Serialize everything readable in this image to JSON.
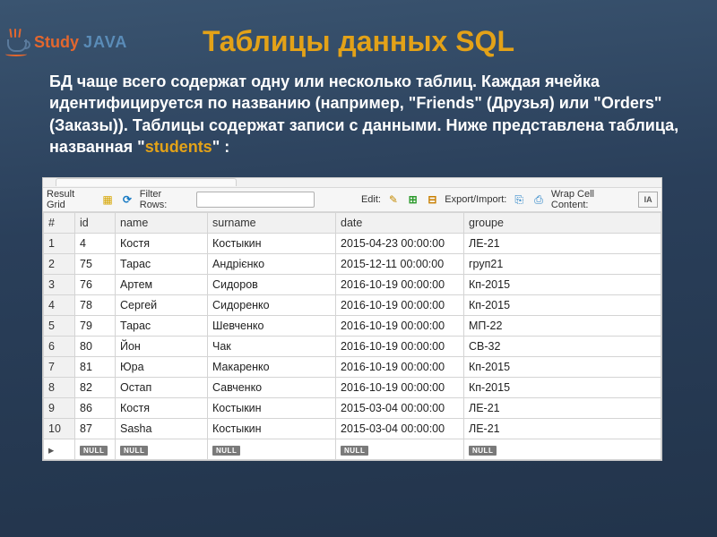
{
  "logo": {
    "study": "Study",
    "java": "JAVA"
  },
  "title": "Таблицы данных SQL",
  "para": {
    "t1": "БД чаще всего содержат одну или несколько таблиц. Каждая ячейка идентифицируется по названию (например, \"Friends\" (Друзья) или \"Orders\" (Заказы)). Таблицы содержат записи с данными. Ниже представлена таблица, названная \"",
    "hl": "students",
    "t2": "\" :"
  },
  "toolbar": {
    "result_grid": "Result Grid",
    "filter_rows": "Filter Rows:",
    "filter_placeholder": "",
    "edit": "Edit:",
    "export_import": "Export/Import:",
    "wrap_cell": "Wrap Cell Content:"
  },
  "columns": {
    "num": "#",
    "id": "id",
    "name": "name",
    "surname": "surname",
    "date": "date",
    "groupe": "groupe"
  },
  "rows": [
    {
      "n": "1",
      "id": "4",
      "name": "Костя",
      "surname": "Костыкин",
      "date": "2015-04-23 00:00:00",
      "groupe": "ЛЕ-21"
    },
    {
      "n": "2",
      "id": "75",
      "name": "Тарас",
      "surname": "Андрієнко",
      "date": "2015-12-11 00:00:00",
      "groupe": "груп21"
    },
    {
      "n": "3",
      "id": "76",
      "name": "Артем",
      "surname": "Сидоров",
      "date": "2016-10-19 00:00:00",
      "groupe": "Кп-2015"
    },
    {
      "n": "4",
      "id": "78",
      "name": "Сергей",
      "surname": "Сидоренко",
      "date": "2016-10-19 00:00:00",
      "groupe": "Кп-2015"
    },
    {
      "n": "5",
      "id": "79",
      "name": "Тарас",
      "surname": "Шевченко",
      "date": "2016-10-19 00:00:00",
      "groupe": "МП-22"
    },
    {
      "n": "6",
      "id": "80",
      "name": "Йон",
      "surname": "Чак",
      "date": "2016-10-19 00:00:00",
      "groupe": "СВ-32"
    },
    {
      "n": "7",
      "id": "81",
      "name": "Юра",
      "surname": "Макаренко",
      "date": "2016-10-19 00:00:00",
      "groupe": "Кп-2015"
    },
    {
      "n": "8",
      "id": "82",
      "name": "Остап",
      "surname": "Савченко",
      "date": "2016-10-19 00:00:00",
      "groupe": "Кп-2015"
    },
    {
      "n": "9",
      "id": "86",
      "name": "Костя",
      "surname": "Костыкин",
      "date": "2015-03-04 00:00:00",
      "groupe": "ЛЕ-21"
    },
    {
      "n": "10",
      "id": "87",
      "name": "Sasha",
      "surname": "Костыкин",
      "date": "2015-03-04 00:00:00",
      "groupe": "ЛЕ-21"
    }
  ],
  "null_label": "NULL"
}
